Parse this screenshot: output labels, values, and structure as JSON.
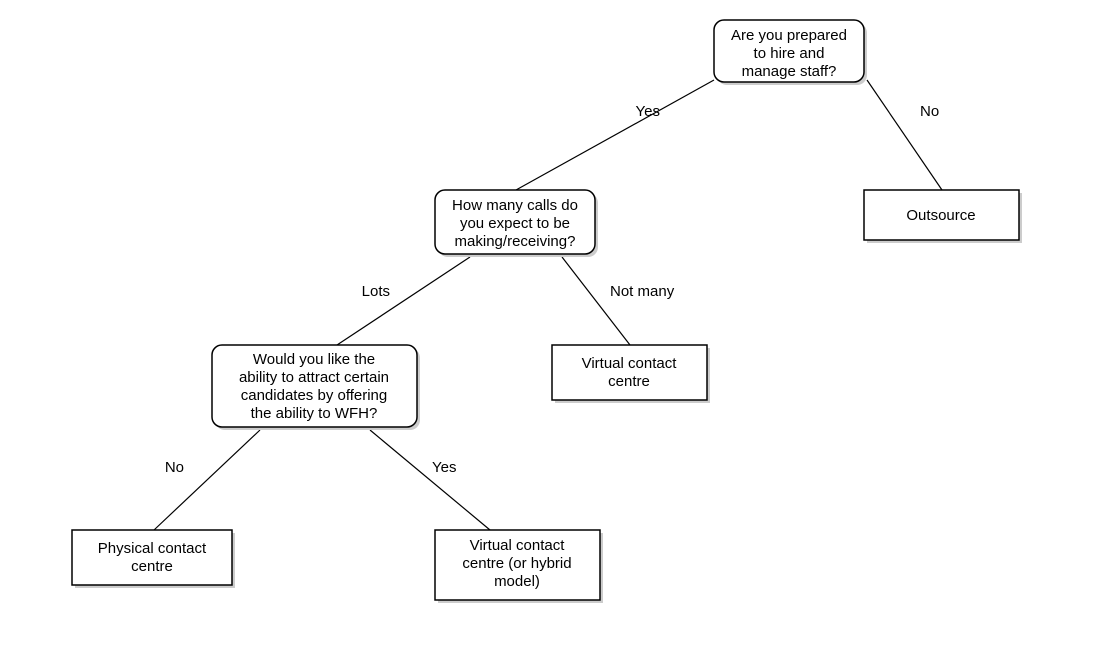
{
  "diagram": {
    "nodes": {
      "q1": {
        "line1": "Are you prepared",
        "line2": "to hire and",
        "line3": "manage staff?"
      },
      "q2": {
        "line1": "How many calls do",
        "line2": "you expect to be",
        "line3": "making/receiving?"
      },
      "q3": {
        "line1": "Would you like the",
        "line2": "ability to attract certain",
        "line3": "candidates by offering",
        "line4": "the ability to WFH?"
      },
      "out_outsource": {
        "line1": "Outsource"
      },
      "out_virtual": {
        "line1": "Virtual contact",
        "line2": "centre"
      },
      "out_physical": {
        "line1": "Physical contact",
        "line2": "centre"
      },
      "out_hybrid": {
        "line1": "Virtual contact",
        "line2": "centre (or hybrid",
        "line3": "model)"
      }
    },
    "edges": {
      "q1_yes": "Yes",
      "q1_no": "No",
      "q2_lots": "Lots",
      "q2_notmany": "Not many",
      "q3_no": "No",
      "q3_yes": "Yes"
    }
  }
}
